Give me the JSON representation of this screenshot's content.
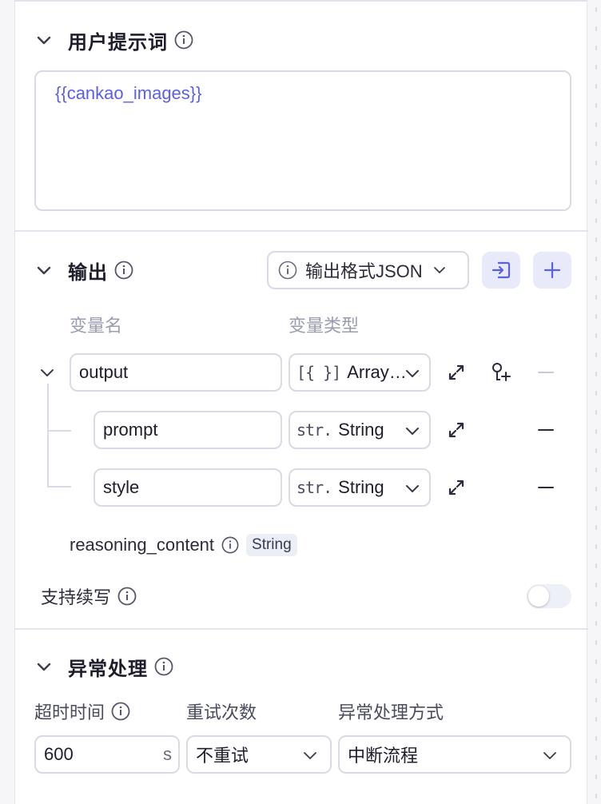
{
  "user_prompt": {
    "title": "用户提示词",
    "content": "{{cankao_images}}"
  },
  "output": {
    "title": "输出",
    "format_select": "输出格式JSON",
    "col_name": "变量名",
    "col_type": "变量类型",
    "vars": [
      {
        "name": "output",
        "type_icon": "[{ }]",
        "type": "Array…"
      },
      {
        "name": "prompt",
        "type_icon": "str.",
        "type": "String"
      },
      {
        "name": "style",
        "type_icon": "str.",
        "type": "String"
      }
    ],
    "reasoning_label": "reasoning_content",
    "reasoning_type": "String",
    "continue_label": "支持续写",
    "continue_enabled": false
  },
  "exception": {
    "title": "异常处理",
    "timeout_label": "超时时间",
    "timeout_value": "600",
    "timeout_unit": "s",
    "retry_label": "重试次数",
    "retry_value": "不重试",
    "method_label": "异常处理方式",
    "method_value": "中断流程"
  },
  "colors": {
    "accent": "#5b5fe6",
    "accent_bg": "#e9eaf9",
    "border": "#d9dbe4",
    "muted": "#9a9cb0"
  }
}
